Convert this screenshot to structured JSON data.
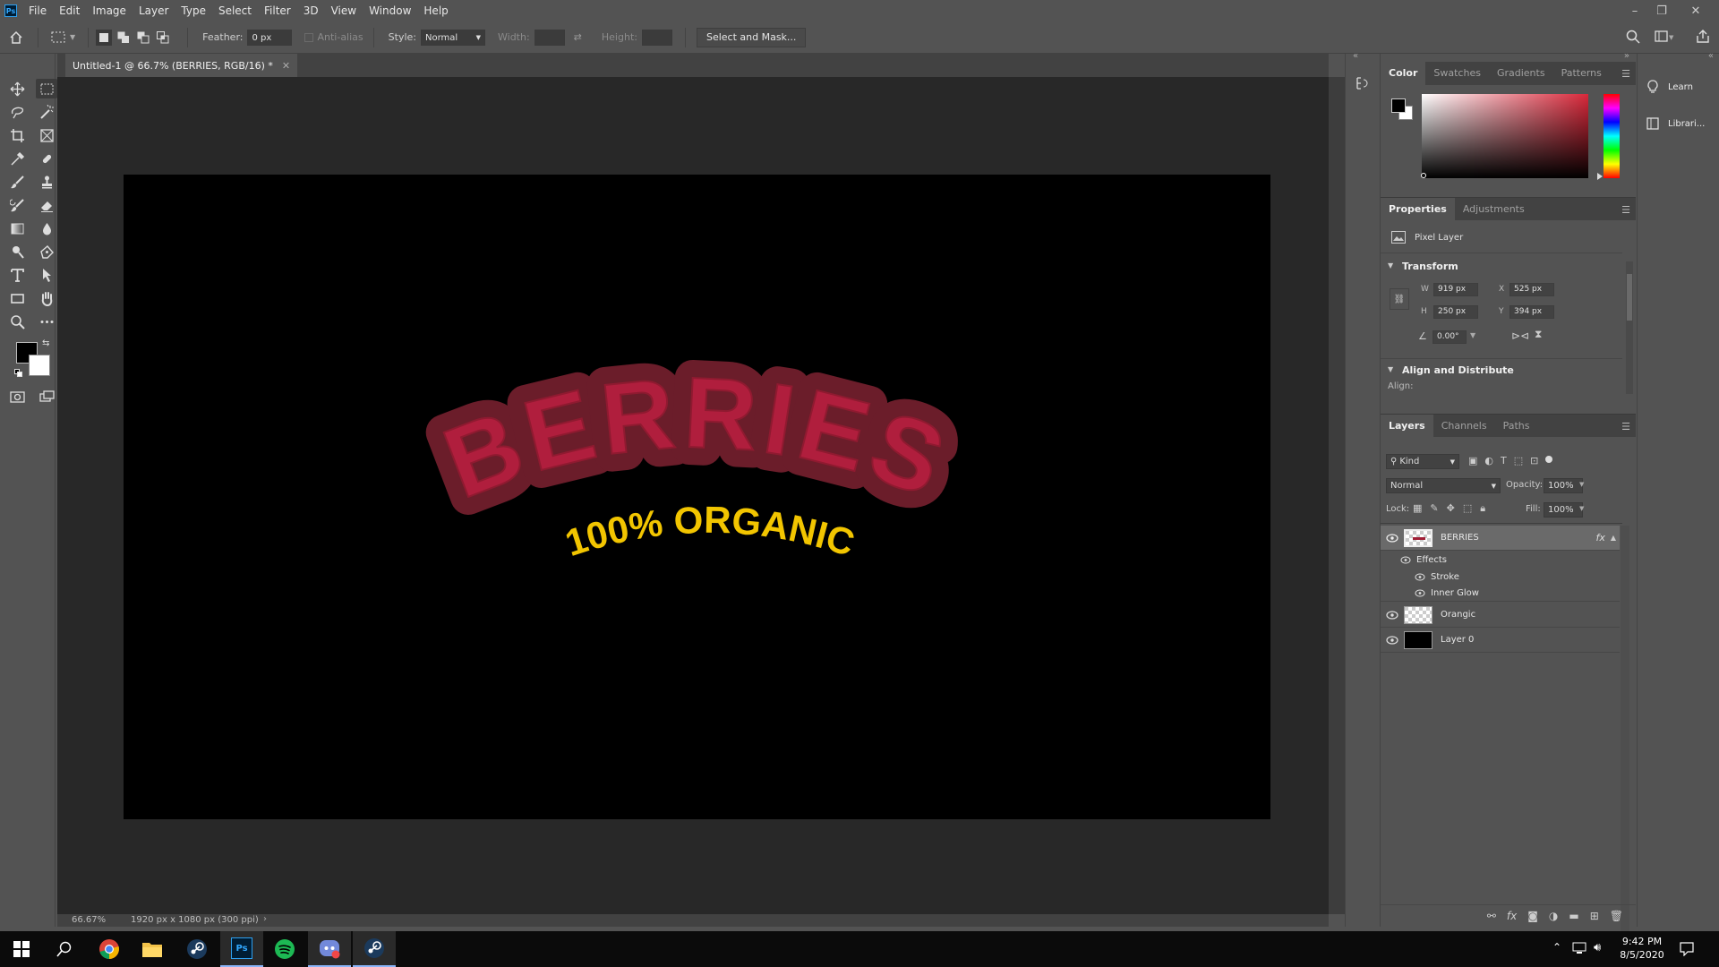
{
  "app": {
    "logo_text": "Ps"
  },
  "menu": [
    "File",
    "Edit",
    "Image",
    "Layer",
    "Type",
    "Select",
    "Filter",
    "3D",
    "View",
    "Window",
    "Help"
  ],
  "options_bar": {
    "feather_label": "Feather:",
    "feather_value": "0 px",
    "antialias_label": "Anti-alias",
    "style_label": "Style:",
    "style_value": "Normal",
    "width_label": "Width:",
    "height_label": "Height:",
    "select_mask_label": "Select and Mask..."
  },
  "document": {
    "tab_title": "Untitled-1 @ 66.7% (BERRIES, RGB/16) *",
    "zoom": "66.67%",
    "info": "1920 px x 1080 px (300 ppi)",
    "canvas_texts": {
      "main": "BERRIES",
      "sub": "100% ORGANIC"
    }
  },
  "color_panel": {
    "tabs": [
      "Color",
      "Swatches",
      "Gradients",
      "Patterns"
    ],
    "fg_color": "#000000",
    "bg_color": "#ffffff",
    "hue_color": "#d8283a"
  },
  "properties_panel": {
    "tabs": [
      "Properties",
      "Adjustments"
    ],
    "kind": "Pixel Layer",
    "transform_title": "Transform",
    "w_label": "W",
    "w_value": "919 px",
    "h_label": "H",
    "h_value": "250 px",
    "x_label": "X",
    "x_value": "525 px",
    "y_label": "Y",
    "y_value": "394 px",
    "angle_value": "0.00°",
    "align_title": "Align and Distribute",
    "align_label": "Align:"
  },
  "layers_panel": {
    "tabs": [
      "Layers",
      "Channels",
      "Paths"
    ],
    "filter_kind": "Kind",
    "blend_mode": "Normal",
    "opacity_label": "Opacity:",
    "opacity_value": "100%",
    "lock_label": "Lock:",
    "fill_label": "Fill:",
    "fill_value": "100%",
    "layers": [
      {
        "name": "BERRIES",
        "fx": "fx",
        "effects_label": "Effects",
        "effects": [
          "Stroke",
          "Inner Glow"
        ]
      },
      {
        "name": "Orangic"
      },
      {
        "name": "Layer 0"
      }
    ]
  },
  "right_dock": {
    "items": [
      "Learn",
      "Librari..."
    ]
  },
  "taskbar": {
    "time": "9:42 PM",
    "date": "8/5/2020",
    "apps": [
      "windows-start",
      "search",
      "chrome",
      "file-explorer",
      "steam",
      "photoshop",
      "spotify",
      "discord",
      "steam-2"
    ]
  }
}
